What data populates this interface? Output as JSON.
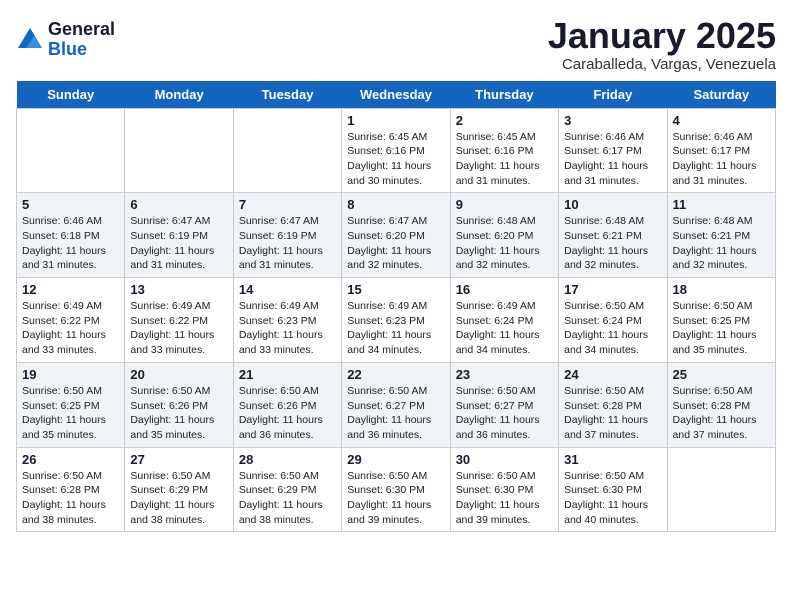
{
  "logo": {
    "general": "General",
    "blue": "Blue"
  },
  "title": "January 2025",
  "location": "Caraballeda, Vargas, Venezuela",
  "days": [
    "Sunday",
    "Monday",
    "Tuesday",
    "Wednesday",
    "Thursday",
    "Friday",
    "Saturday"
  ],
  "weeks": [
    [
      {
        "day": "",
        "info": ""
      },
      {
        "day": "",
        "info": ""
      },
      {
        "day": "",
        "info": ""
      },
      {
        "day": "1",
        "info": "Sunrise: 6:45 AM\nSunset: 6:16 PM\nDaylight: 11 hours\nand 30 minutes."
      },
      {
        "day": "2",
        "info": "Sunrise: 6:45 AM\nSunset: 6:16 PM\nDaylight: 11 hours\nand 31 minutes."
      },
      {
        "day": "3",
        "info": "Sunrise: 6:46 AM\nSunset: 6:17 PM\nDaylight: 11 hours\nand 31 minutes."
      },
      {
        "day": "4",
        "info": "Sunrise: 6:46 AM\nSunset: 6:17 PM\nDaylight: 11 hours\nand 31 minutes."
      }
    ],
    [
      {
        "day": "5",
        "info": "Sunrise: 6:46 AM\nSunset: 6:18 PM\nDaylight: 11 hours\nand 31 minutes."
      },
      {
        "day": "6",
        "info": "Sunrise: 6:47 AM\nSunset: 6:19 PM\nDaylight: 11 hours\nand 31 minutes."
      },
      {
        "day": "7",
        "info": "Sunrise: 6:47 AM\nSunset: 6:19 PM\nDaylight: 11 hours\nand 31 minutes."
      },
      {
        "day": "8",
        "info": "Sunrise: 6:47 AM\nSunset: 6:20 PM\nDaylight: 11 hours\nand 32 minutes."
      },
      {
        "day": "9",
        "info": "Sunrise: 6:48 AM\nSunset: 6:20 PM\nDaylight: 11 hours\nand 32 minutes."
      },
      {
        "day": "10",
        "info": "Sunrise: 6:48 AM\nSunset: 6:21 PM\nDaylight: 11 hours\nand 32 minutes."
      },
      {
        "day": "11",
        "info": "Sunrise: 6:48 AM\nSunset: 6:21 PM\nDaylight: 11 hours\nand 32 minutes."
      }
    ],
    [
      {
        "day": "12",
        "info": "Sunrise: 6:49 AM\nSunset: 6:22 PM\nDaylight: 11 hours\nand 33 minutes."
      },
      {
        "day": "13",
        "info": "Sunrise: 6:49 AM\nSunset: 6:22 PM\nDaylight: 11 hours\nand 33 minutes."
      },
      {
        "day": "14",
        "info": "Sunrise: 6:49 AM\nSunset: 6:23 PM\nDaylight: 11 hours\nand 33 minutes."
      },
      {
        "day": "15",
        "info": "Sunrise: 6:49 AM\nSunset: 6:23 PM\nDaylight: 11 hours\nand 34 minutes."
      },
      {
        "day": "16",
        "info": "Sunrise: 6:49 AM\nSunset: 6:24 PM\nDaylight: 11 hours\nand 34 minutes."
      },
      {
        "day": "17",
        "info": "Sunrise: 6:50 AM\nSunset: 6:24 PM\nDaylight: 11 hours\nand 34 minutes."
      },
      {
        "day": "18",
        "info": "Sunrise: 6:50 AM\nSunset: 6:25 PM\nDaylight: 11 hours\nand 35 minutes."
      }
    ],
    [
      {
        "day": "19",
        "info": "Sunrise: 6:50 AM\nSunset: 6:25 PM\nDaylight: 11 hours\nand 35 minutes."
      },
      {
        "day": "20",
        "info": "Sunrise: 6:50 AM\nSunset: 6:26 PM\nDaylight: 11 hours\nand 35 minutes."
      },
      {
        "day": "21",
        "info": "Sunrise: 6:50 AM\nSunset: 6:26 PM\nDaylight: 11 hours\nand 36 minutes."
      },
      {
        "day": "22",
        "info": "Sunrise: 6:50 AM\nSunset: 6:27 PM\nDaylight: 11 hours\nand 36 minutes."
      },
      {
        "day": "23",
        "info": "Sunrise: 6:50 AM\nSunset: 6:27 PM\nDaylight: 11 hours\nand 36 minutes."
      },
      {
        "day": "24",
        "info": "Sunrise: 6:50 AM\nSunset: 6:28 PM\nDaylight: 11 hours\nand 37 minutes."
      },
      {
        "day": "25",
        "info": "Sunrise: 6:50 AM\nSunset: 6:28 PM\nDaylight: 11 hours\nand 37 minutes."
      }
    ],
    [
      {
        "day": "26",
        "info": "Sunrise: 6:50 AM\nSunset: 6:28 PM\nDaylight: 11 hours\nand 38 minutes."
      },
      {
        "day": "27",
        "info": "Sunrise: 6:50 AM\nSunset: 6:29 PM\nDaylight: 11 hours\nand 38 minutes."
      },
      {
        "day": "28",
        "info": "Sunrise: 6:50 AM\nSunset: 6:29 PM\nDaylight: 11 hours\nand 38 minutes."
      },
      {
        "day": "29",
        "info": "Sunrise: 6:50 AM\nSunset: 6:30 PM\nDaylight: 11 hours\nand 39 minutes."
      },
      {
        "day": "30",
        "info": "Sunrise: 6:50 AM\nSunset: 6:30 PM\nDaylight: 11 hours\nand 39 minutes."
      },
      {
        "day": "31",
        "info": "Sunrise: 6:50 AM\nSunset: 6:30 PM\nDaylight: 11 hours\nand 40 minutes."
      },
      {
        "day": "",
        "info": ""
      }
    ]
  ]
}
